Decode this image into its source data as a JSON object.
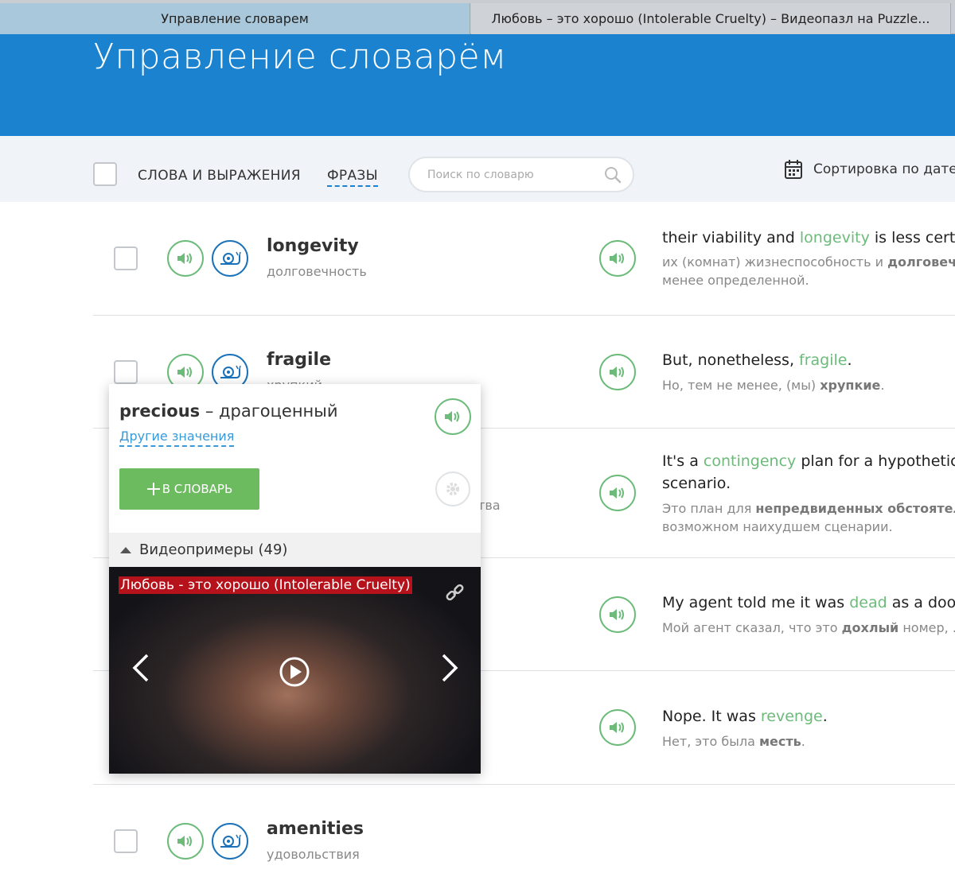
{
  "tabs": [
    {
      "label": "Управление словарем"
    },
    {
      "label": "Любовь – это хорошо (Intolerable Cruelty) – Видеопазл на Puzzle..."
    }
  ],
  "header": {
    "title": "Управление словарём"
  },
  "toolbar": {
    "words_label": "СЛОВА И ВЫРАЖЕНИЯ",
    "phrases_label": "ФРАЗЫ",
    "search_placeholder": "Поиск по словарю",
    "sort_label": "Сортировка по дате"
  },
  "rows": [
    {
      "word": "longevity",
      "translation": "долговечность",
      "example_pre": "their viability and ",
      "example_hl": "longevity",
      "example_post": " is less certain",
      "translation_line1_pre": "их (комнат) жизнеспособность и ",
      "translation_line1_bold": "долговечность",
      "translation_line2": "менее определенной."
    },
    {
      "word": "fragile",
      "translation": "хрупкий",
      "example_pre": "But, nonetheless, ",
      "example_hl": "fragile",
      "example_post": ".",
      "translation_pre": "Но, тем не менее, (мы) ",
      "translation_bold": "хрупкие",
      "translation_post": "."
    },
    {
      "word_hidden_suffix": "тва",
      "example_pre": "It's a ",
      "example_hl": "contingency",
      "example_post": " plan for a hypothetical",
      "example_line2": "scenario.",
      "translation_line1_pre": "Это план для ",
      "translation_line1_bold": "непредвиденных обстоятельств",
      "translation_line2": "возможном наихудшем сценарии."
    },
    {
      "example_pre": "My agent told me it was ",
      "example_hl": "dead",
      "example_post": " as a doornail",
      "translation_pre": "Мой агент сказал, что это ",
      "translation_bold": "дохлый",
      "translation_post": " номер, ..."
    },
    {
      "example_pre": "Nope. It was ",
      "example_hl": "revenge",
      "example_post": ".",
      "translation_pre": "Нет, это была ",
      "translation_bold": "месть",
      "translation_post": "."
    },
    {
      "word": "amenities",
      "translation": "удовольствия"
    }
  ],
  "popup": {
    "word": "precious",
    "dash": " – ",
    "translation": "драгоценный",
    "other_meanings": "Другие значения",
    "add_button": "В СЛОВАРЬ",
    "videos_label": "Видеопримеры (49)",
    "video_title": "Любовь - это хорошо (Intolerable Cruelty)"
  },
  "colors": {
    "header_blue": "#1a82cf",
    "green": "#6cbb7a",
    "snail_blue": "#1b72b9",
    "video_title_bg": "#b5121b"
  },
  "icons": [
    "sound-icon",
    "snail-icon",
    "search-icon",
    "calendar-icon",
    "gear-icon",
    "play-icon",
    "chevron-left-icon",
    "chevron-right-icon",
    "link-icon",
    "plus-icon"
  ]
}
